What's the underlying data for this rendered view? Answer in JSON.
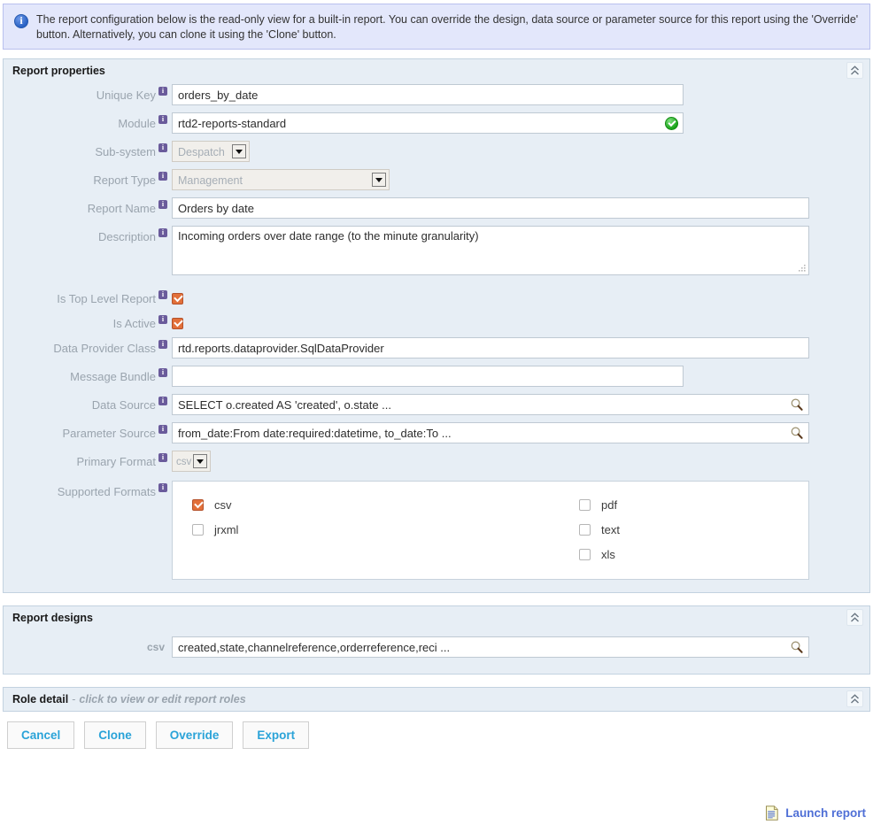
{
  "banner": {
    "icon": "info-circle-icon",
    "text": "The report configuration below is the read-only view for a built-in report. You can override the design, data source or parameter source for this report using the 'Override' button. Alternatively, you can clone it using the 'Clone' button."
  },
  "report_properties": {
    "title": "Report properties",
    "collapse_icon": "double-chevron-up-icon",
    "fields": {
      "unique_key": {
        "label": "Unique Key",
        "value": "orders_by_date"
      },
      "module": {
        "label": "Module",
        "value": "rtd2-reports-standard",
        "status_icon": "green-check-icon"
      },
      "sub_system": {
        "label": "Sub-system",
        "value": "Despatch"
      },
      "report_type": {
        "label": "Report Type",
        "value": "Management"
      },
      "report_name": {
        "label": "Report Name",
        "value": "Orders by date"
      },
      "description": {
        "label": "Description",
        "value": "Incoming orders over date range (to the minute granularity)"
      },
      "is_top_level_report": {
        "label": "Is Top Level Report",
        "checked": true
      },
      "is_active": {
        "label": "Is Active",
        "checked": true
      },
      "data_provider_class": {
        "label": "Data Provider Class",
        "value": "rtd.reports.dataprovider.SqlDataProvider"
      },
      "message_bundle": {
        "label": "Message Bundle",
        "value": ""
      },
      "data_source": {
        "label": "Data Source",
        "value": "SELECT o.created AS 'created', o.state ...",
        "search_icon": "magnifier-icon"
      },
      "parameter_source": {
        "label": "Parameter Source",
        "value": "from_date:From date:required:datetime, to_date:To ...",
        "search_icon": "magnifier-icon"
      },
      "primary_format": {
        "label": "Primary Format",
        "value": "csv"
      },
      "supported_formats": {
        "label": "Supported Formats",
        "options": [
          {
            "label": "csv",
            "checked": true
          },
          {
            "label": "jrxml",
            "checked": false
          },
          {
            "label": "pdf",
            "checked": false
          },
          {
            "label": "text",
            "checked": false
          },
          {
            "label": "xls",
            "checked": false
          }
        ]
      }
    }
  },
  "report_designs": {
    "title": "Report designs",
    "collapse_icon": "double-chevron-up-icon",
    "row_label": "csv",
    "row_value": "created,state,channelreference,orderreference,reci ...",
    "search_icon": "magnifier-icon"
  },
  "role_detail": {
    "title": "Role detail",
    "dash": "-",
    "subtitle": "click to view or edit report roles",
    "collapse_icon": "double-chevron-up-icon"
  },
  "buttons": {
    "cancel": "Cancel",
    "clone": "Clone",
    "override": "Override",
    "export": "Export"
  },
  "launch": {
    "label": "Launch report",
    "icon": "report-document-icon"
  },
  "colors": {
    "panel_bg": "#e7eef5",
    "banner_bg": "#e3e7fb",
    "accent_link": "#2aa3d8",
    "launch_link": "#4f6fd6",
    "checkbox_checked": "#e2703a",
    "info_tip": "#6a5b9b"
  }
}
